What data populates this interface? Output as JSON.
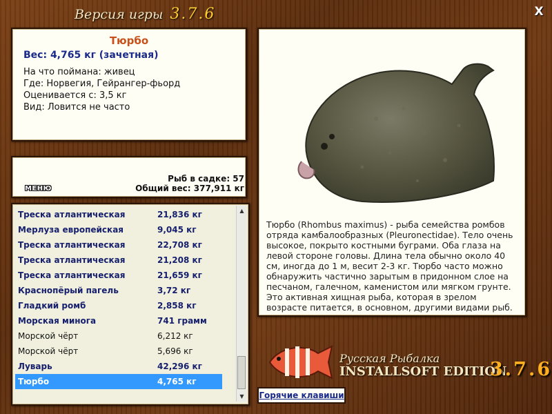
{
  "window": {
    "title_label": "Версия игры",
    "title_version": "3.7.6",
    "close_label": "X"
  },
  "catch": {
    "fish_name": "Тюрбо",
    "weight_line": "Вес: 4,765 кг (зачетная)",
    "bait_line": "На что поймана: живец",
    "place_line": "Где: Норвегия, Гейрангер-фьорд",
    "eval_line": "Оценивается с: 3,5 кг",
    "kind_line": "Вид: Ловится не часто"
  },
  "stats": {
    "menu_label": "МЕНЮ",
    "count_line": "Рыб в садке: 57",
    "total_line": "Общий вес: 377,911 кг"
  },
  "list": {
    "rows": [
      {
        "name": "Треска атлантическая",
        "weight": "21,836 кг",
        "style": "bold"
      },
      {
        "name": "Мерлуза европейская",
        "weight": "9,045 кг",
        "style": "bold"
      },
      {
        "name": "Треска атлантическая",
        "weight": "22,708 кг",
        "style": "bold"
      },
      {
        "name": "Треска атлантическая",
        "weight": "21,208 кг",
        "style": "bold"
      },
      {
        "name": "Треска атлантическая",
        "weight": "21,659 кг",
        "style": "bold"
      },
      {
        "name": "Краснопёрый пагель",
        "weight": "3,72 кг",
        "style": "bold"
      },
      {
        "name": "Гладкий ромб",
        "weight": "2,858 кг",
        "style": "bold"
      },
      {
        "name": "Морская минога",
        "weight": "741 грамм",
        "style": "bold"
      },
      {
        "name": "Морской чёрт",
        "weight": "6,212 кг",
        "style": "normal"
      },
      {
        "name": "Морской чёрт",
        "weight": "5,696 кг",
        "style": "normal"
      },
      {
        "name": "Луварь",
        "weight": "42,296 кг",
        "style": "bold"
      },
      {
        "name": "Тюрбо",
        "weight": "4,765 кг",
        "style": "selected"
      }
    ]
  },
  "description": "Тюрбо (Rhombus maximus) - рыба семейства ромбов отряда камбалообразных (Pleuronectidae). Тело очень высокое, покрыто костными буграми. Оба глаза на левой стороне головы. Длина тела обычно около 40 см, иногда до 1 м, весит 2-3 кг. Тюрбо часто можно обнаружить частично зарытым в придонном слое на песчаном, галечном, каменистом или мягком грунте. Это активная хищная рыба, которая в зрелом возрасте питается, в основном, другими видами рыб.",
  "brand": {
    "line1": "Русская Рыбалка",
    "line2": "INSTALLSOFT EDITION",
    "version": "3.7.6"
  },
  "hotkeys_label": "Горячие клавиши",
  "colors": {
    "accent_name": "#c8501a",
    "list_bold": "#16206e",
    "selected_bg": "#3399ff",
    "wood": "#6e3812"
  }
}
